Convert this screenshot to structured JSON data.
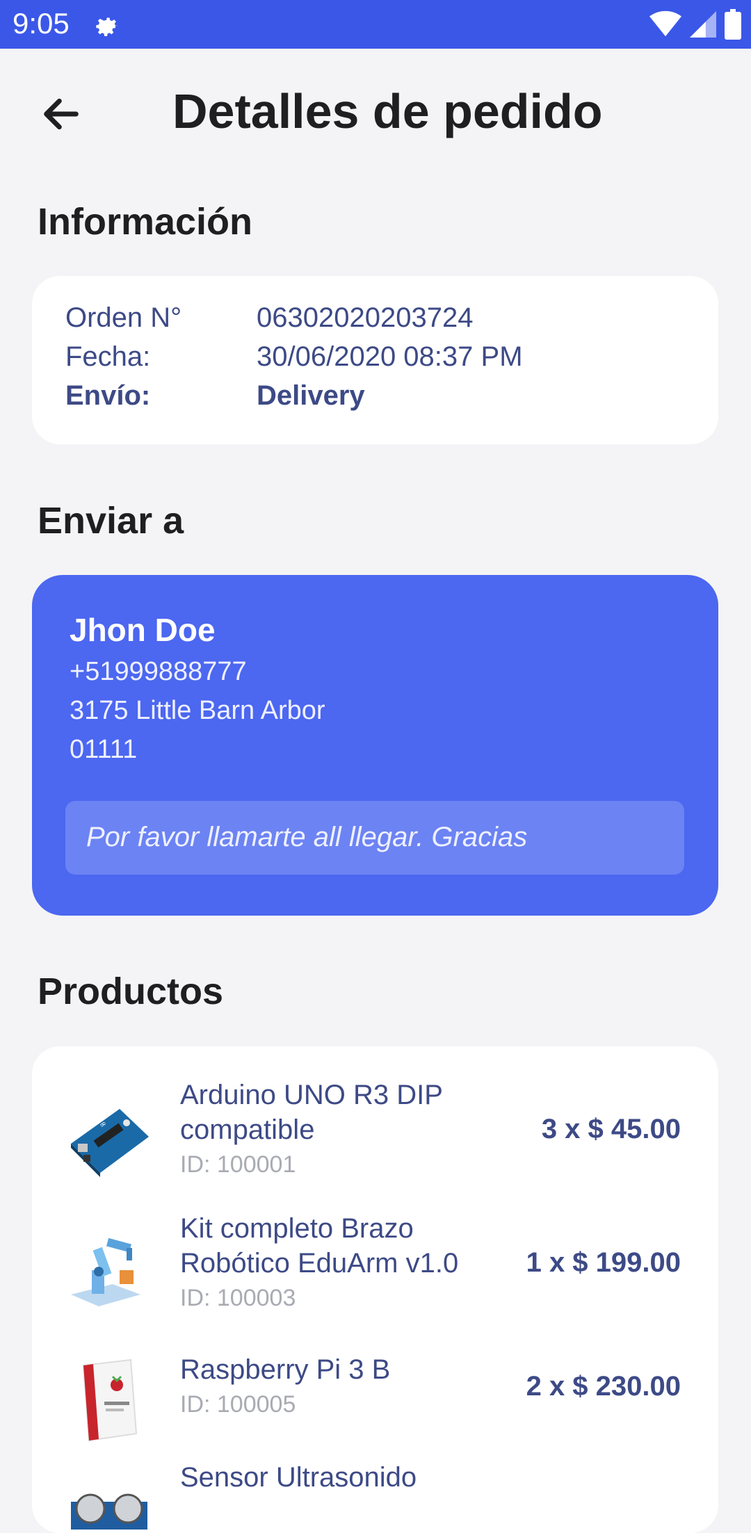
{
  "status_bar": {
    "time": "9:05",
    "icons": [
      "gear-icon",
      "wifi-icon",
      "signal-icon",
      "battery-icon"
    ],
    "color": "#3a57e8"
  },
  "header": {
    "title": "Detalles de pedido",
    "back_icon": "arrow-left-icon"
  },
  "info": {
    "section_title": "Información",
    "rows": [
      {
        "label": "Orden N°",
        "value": "06302020203724"
      },
      {
        "label": "Fecha:",
        "value": "30/06/2020 08:37 PM"
      },
      {
        "label": "Envío:",
        "value": "Delivery"
      }
    ]
  },
  "shipping": {
    "section_title": "Enviar a",
    "name": "Jhon Doe",
    "phone": "+51999888777",
    "address": "3175 Little Barn Arbor",
    "postal_code": "01111",
    "note": "Por favor llamarte all llegar. Gracias",
    "card_color": "#4c67f0"
  },
  "products": {
    "section_title": "Productos",
    "items": [
      {
        "name": "Arduino UNO R3 DIP compatible",
        "id_text": "ID: 100001",
        "price": "3 x $ 45.00",
        "thumb_icon": "arduino-board-icon"
      },
      {
        "name": "Kit completo Brazo Robótico EduArm v1.0",
        "id_text": "ID: 100003",
        "price": "1 x $ 199.00",
        "thumb_icon": "robot-arm-icon"
      },
      {
        "name": "Raspberry Pi 3 B",
        "id_text": "ID: 100005",
        "price": "2 x $ 230.00",
        "thumb_icon": "raspberry-pi-box-icon"
      },
      {
        "name": "Sensor Ultrasonido",
        "thumb_icon": "ultrasonic-sensor-icon"
      }
    ]
  }
}
